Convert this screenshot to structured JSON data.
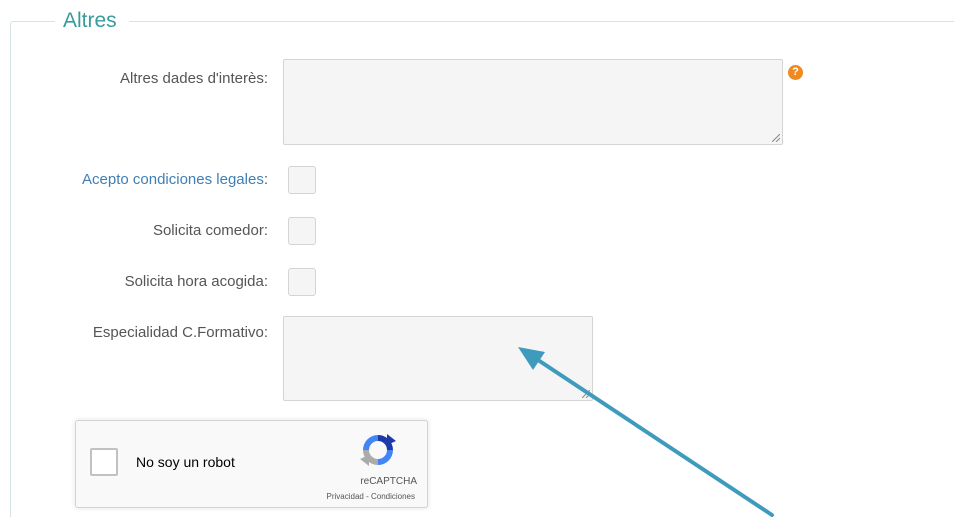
{
  "fieldset": {
    "legend": "Altres"
  },
  "fields": {
    "altres_dades_label": "Altres dades d'interès:",
    "altres_dades_value": "",
    "acepto_label": "Acepto condiciones legales",
    "acepto_colon": ":",
    "solicita_comedor_label": "Solicita comedor:",
    "solicita_hora_label": "Solicita hora acogida:",
    "especialidad_label": "Especialidad C.Formativo:",
    "especialidad_value": "",
    "help_icon_glyph": "?"
  },
  "recaptcha": {
    "label": "No soy un robot",
    "brand": "reCAPTCHA",
    "links": "Privacidad - Condiciones"
  },
  "colors": {
    "legend": "#3a9b9b",
    "link": "#3f7fb5",
    "help_icon": "#f0891e",
    "annotation_arrow": "#4aa3c0"
  },
  "icons": {
    "help": "question-mark-circle-icon",
    "recaptcha": "recaptcha-logo-icon",
    "annotation": "annotation-arrow-icon"
  }
}
